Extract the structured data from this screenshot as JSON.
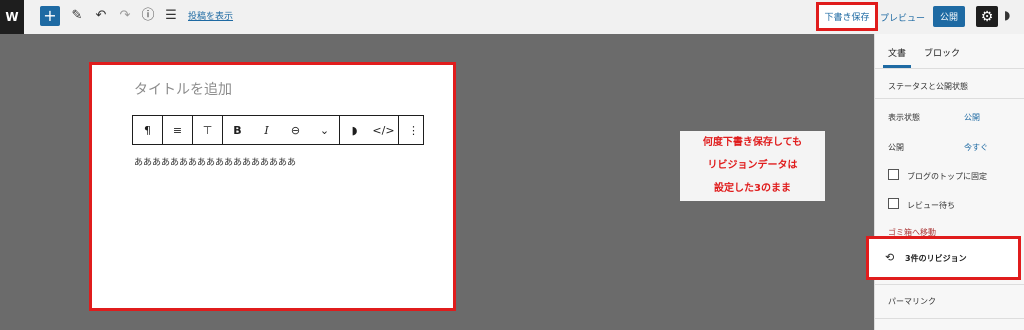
{
  "topbar": {
    "logo": "W",
    "add_icon": "+",
    "pencil_icon": "✎",
    "undo_icon": "↶",
    "redo_icon": "↷",
    "info_icon": "ⓘ",
    "list_icon": "☰",
    "outline_link": "投稿を表示",
    "save_draft": "下書き保存",
    "preview": "プレビュー",
    "publish": "公開",
    "settings_icon": "⚙",
    "jetpack_icon": "◗"
  },
  "editor": {
    "title_placeholder": "タイトルを追加",
    "toolbar": {
      "paragraph_icon": "¶",
      "align_icon": "≡",
      "format_icon": "⊤",
      "bold": "B",
      "italic": "I",
      "link_icon": "⊖",
      "more_icon": "⌄",
      "jetpack_icon": "◗",
      "code_icon": "</>",
      "options_icon": "⋮"
    },
    "paragraph_text": "ああああああああああああああああああ"
  },
  "annotation": {
    "lines": [
      "何度下書き保存しても",
      "リビジョンデータは",
      "設定した3のまま"
    ]
  },
  "sidebar": {
    "tabs": [
      "文書",
      "ブロック"
    ],
    "status_heading": "ステータスと公開状態",
    "visibility_label": "表示状態",
    "visibility_value": "公開",
    "publish_label": "公開",
    "publish_value": "今すぐ",
    "stick_label": "ブログのトップに固定",
    "pending_label": "レビュー待ち",
    "trash_label": "ゴミ箱へ移動",
    "revisions_label": "3件のリビジョン",
    "revisions_icon": "⟲",
    "permalink_label": "パーマリンク"
  },
  "colors": {
    "accent": "#1e6aa3",
    "highlight": "#e01c1c"
  }
}
